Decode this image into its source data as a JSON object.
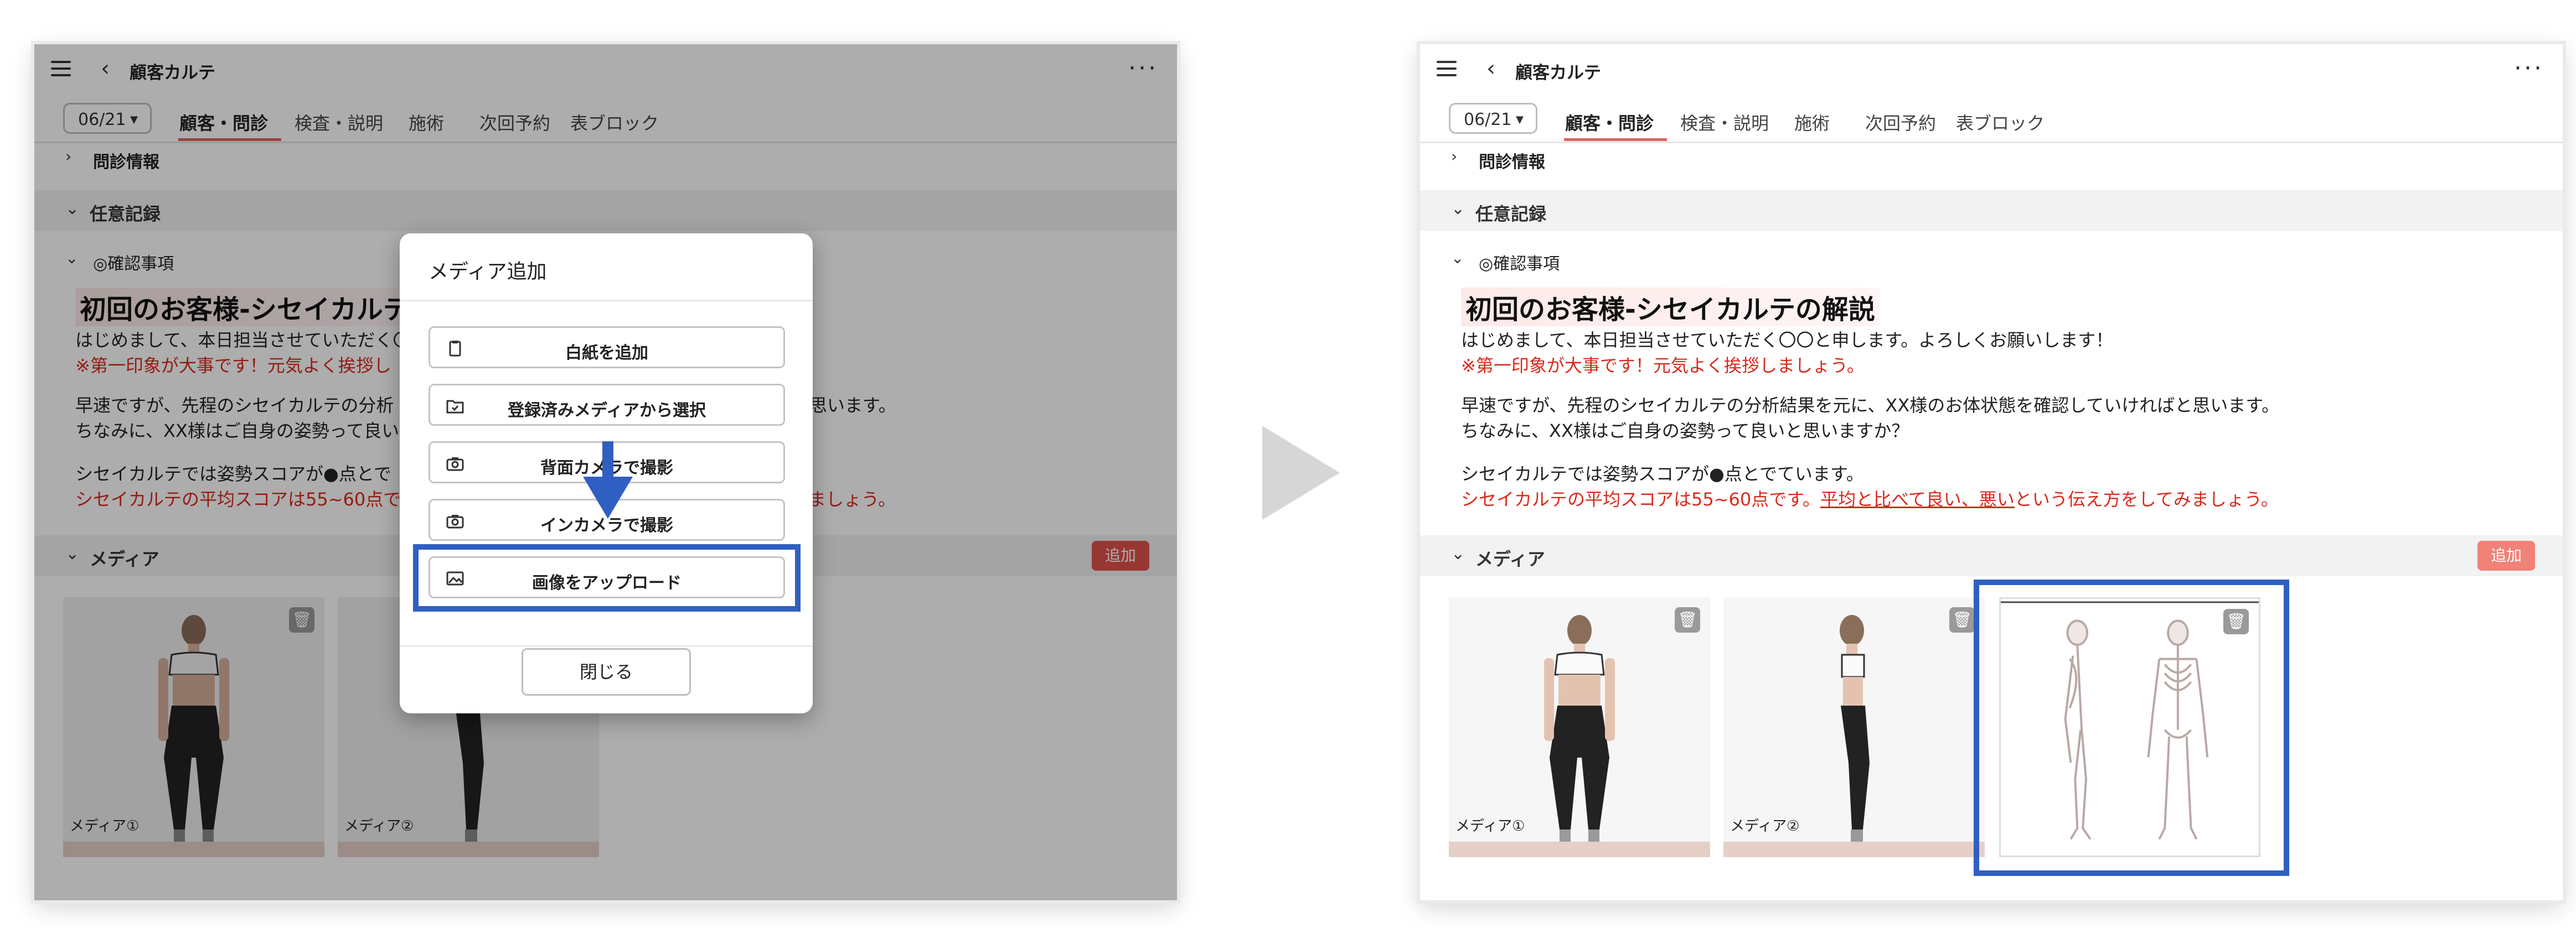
{
  "header": {
    "title": "顧客カルテ"
  },
  "tabs": {
    "date": "06/21",
    "items": [
      "顧客・問診",
      "検査・説明",
      "施術",
      "次回予約",
      "表ブロック"
    ]
  },
  "sections": {
    "monshin": "問診情報",
    "nini": "任意記録",
    "kakunin": "◎確認事項",
    "media": "メディア",
    "media_add": "追加"
  },
  "content": {
    "heading": "初回のお客様-シセイカルテの解説",
    "line1": "はじめまして、本日担当させていただく〇〇と申します。よろしくお願いします！",
    "line2_red": "※第一印象が大事です！元気よく挨拶しましょう。",
    "line3": "早速ですが、先程のシセイカルテの分析結果を元に、XX様のお体状態を確認していければと思います。",
    "line4": "ちなみに、XX様はご自身の姿勢って良いと思いますか？",
    "line5": "シセイカルテでは姿勢スコアが●点とでています。",
    "line6_a": "シセイカルテの平均スコアは55~60点です。",
    "line6_b": "平均と比べて良い、悪い",
    "line6_c": "という伝え方をしてみましょう。"
  },
  "left_visible": {
    "heading": "初回のお客様-シセイカルテ",
    "line2": "※第一印象が大事です！元気よく挨拶し",
    "line3a": "早速ですが、先程のシセイカルテの分析",
    "line3b": "思います。",
    "line4": "ちなみに、XX様はご自身の姿勢って良い",
    "line5": "シセイカルテでは姿勢スコアが●点とで",
    "line6": "シセイカルテの平均スコアは55~60点で",
    "line6b": "ましょう。"
  },
  "media": {
    "items": [
      {
        "caption": "メディア①"
      },
      {
        "caption": "メディア②"
      }
    ]
  },
  "modal": {
    "title": "メディア追加",
    "options": [
      "白紙を追加",
      "登録済みメディアから選択",
      "背面カメラで撮影",
      "インカメラで撮影",
      "画像をアップロード"
    ],
    "close": "閉じる"
  },
  "colors": {
    "accent_red": "#e0524a",
    "highlight_blue": "#2f5fc1",
    "tab_underline": "#e0625f"
  }
}
